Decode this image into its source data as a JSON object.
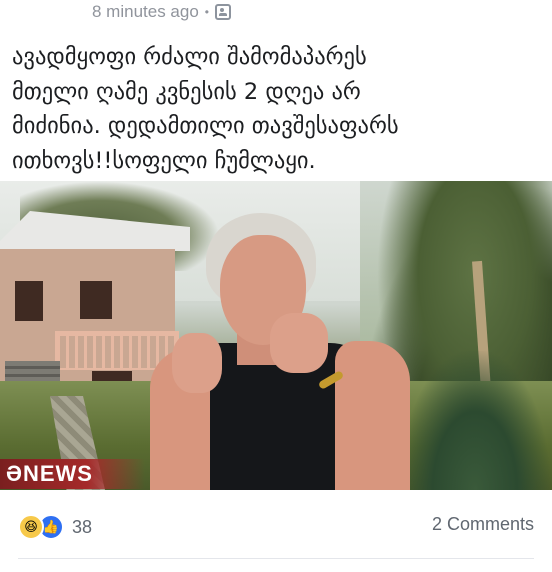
{
  "header": {
    "timestamp": "8 minutes ago",
    "separator": "•",
    "audience_icon": "public-audience-icon"
  },
  "post": {
    "text": "ავადმყოფი რძალი შამომაპარეს\nმთელი ღამე კვნესის 2 დღეა არ\nმიძინია. დედამთილი თავშესაფარს\nითხოვს!!სოფელი ჩუმლაყი."
  },
  "media": {
    "watermark": "ƏNEWS",
    "description_icon": "video-frame"
  },
  "footer": {
    "reaction_icons": [
      "haha-reaction-icon",
      "like-reaction-icon"
    ],
    "reaction_count": "38",
    "comments": "2 Comments"
  },
  "colors": {
    "secondary_text": "#90949c",
    "primary_text": "#1c1e21",
    "like_blue": "#2e6ff2",
    "haha_yellow": "#f7c94a",
    "news_red": "#a52a2a"
  }
}
